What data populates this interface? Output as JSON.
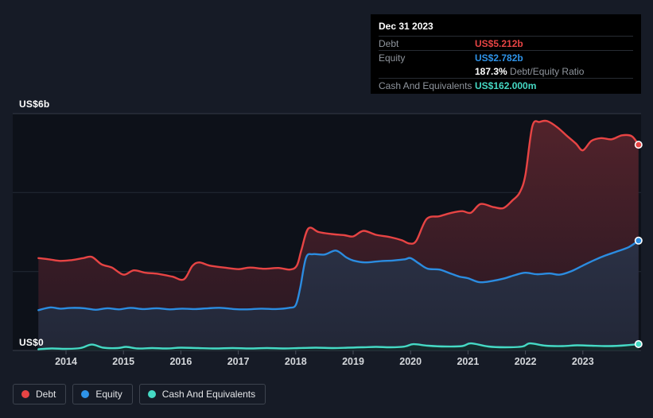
{
  "page": {
    "background": "#161b26"
  },
  "tooltip": {
    "date": "Dec 31 2023",
    "debt_label": "Debt",
    "debt_value": "US$5.212b",
    "equity_label": "Equity",
    "equity_value": "US$2.782b",
    "ratio_value": "187.3%",
    "ratio_label": "Debt/Equity Ratio",
    "cash_label": "Cash And Equivalents",
    "cash_value": "US$162.000m"
  },
  "legend": {
    "items": [
      {
        "label": "Debt",
        "color": "#e74444"
      },
      {
        "label": "Equity",
        "color": "#2e93e8"
      },
      {
        "label": "Cash And Equivalents",
        "color": "#45d9c4"
      }
    ]
  },
  "chart_data": {
    "type": "area",
    "title": "",
    "xlabel": "",
    "ylabel": "",
    "ylim": [
      0,
      6
    ],
    "x_range": [
      2013.5,
      2024.0
    ],
    "grid_values": [
      0,
      2,
      4,
      6
    ],
    "y_axis": {
      "top_label": "US$6b",
      "bottom_label": "US$0",
      "unit": "US$ billions"
    },
    "x_ticks": [
      "2014",
      "2015",
      "2016",
      "2017",
      "2018",
      "2019",
      "2020",
      "2021",
      "2022",
      "2023"
    ],
    "legend_position": "bottom-left",
    "grid": true,
    "series": [
      {
        "name": "Debt",
        "color": "#e74444",
        "fill_top": "#53232b",
        "fill_bottom": "#261722",
        "end_value_label": "US$5.212b",
        "points": [
          [
            2013.52,
            2.34
          ],
          [
            2013.7,
            2.31
          ],
          [
            2013.9,
            2.27
          ],
          [
            2014.1,
            2.29
          ],
          [
            2014.3,
            2.34
          ],
          [
            2014.45,
            2.37
          ],
          [
            2014.62,
            2.18
          ],
          [
            2014.8,
            2.1
          ],
          [
            2015.0,
            1.92
          ],
          [
            2015.18,
            2.03
          ],
          [
            2015.38,
            1.97
          ],
          [
            2015.6,
            1.94
          ],
          [
            2015.85,
            1.87
          ],
          [
            2016.05,
            1.8
          ],
          [
            2016.2,
            2.14
          ],
          [
            2016.32,
            2.23
          ],
          [
            2016.5,
            2.15
          ],
          [
            2016.75,
            2.1
          ],
          [
            2017.0,
            2.06
          ],
          [
            2017.2,
            2.1
          ],
          [
            2017.45,
            2.07
          ],
          [
            2017.7,
            2.09
          ],
          [
            2017.9,
            2.05
          ],
          [
            2018.02,
            2.15
          ],
          [
            2018.1,
            2.55
          ],
          [
            2018.22,
            3.09
          ],
          [
            2018.4,
            3.0
          ],
          [
            2018.62,
            2.95
          ],
          [
            2018.85,
            2.92
          ],
          [
            2019.0,
            2.89
          ],
          [
            2019.18,
            3.03
          ],
          [
            2019.4,
            2.93
          ],
          [
            2019.65,
            2.87
          ],
          [
            2019.85,
            2.79
          ],
          [
            2019.98,
            2.71
          ],
          [
            2020.1,
            2.78
          ],
          [
            2020.28,
            3.33
          ],
          [
            2020.5,
            3.4
          ],
          [
            2020.72,
            3.49
          ],
          [
            2020.9,
            3.53
          ],
          [
            2021.05,
            3.49
          ],
          [
            2021.22,
            3.71
          ],
          [
            2021.45,
            3.63
          ],
          [
            2021.62,
            3.61
          ],
          [
            2021.78,
            3.81
          ],
          [
            2021.9,
            4.0
          ],
          [
            2022.0,
            4.45
          ],
          [
            2022.12,
            5.68
          ],
          [
            2022.25,
            5.79
          ],
          [
            2022.38,
            5.81
          ],
          [
            2022.55,
            5.66
          ],
          [
            2022.72,
            5.44
          ],
          [
            2022.88,
            5.24
          ],
          [
            2023.0,
            5.07
          ],
          [
            2023.15,
            5.31
          ],
          [
            2023.32,
            5.38
          ],
          [
            2023.5,
            5.35
          ],
          [
            2023.68,
            5.45
          ],
          [
            2023.85,
            5.43
          ],
          [
            2023.97,
            5.212
          ]
        ]
      },
      {
        "name": "Equity",
        "color": "#2b8ce0",
        "fill_top": "#353c55",
        "fill_bottom": "#222737",
        "end_value_label": "US$2.782b",
        "points": [
          [
            2013.52,
            1.02
          ],
          [
            2013.72,
            1.09
          ],
          [
            2013.9,
            1.06
          ],
          [
            2014.1,
            1.08
          ],
          [
            2014.32,
            1.07
          ],
          [
            2014.52,
            1.03
          ],
          [
            2014.72,
            1.07
          ],
          [
            2014.92,
            1.04
          ],
          [
            2015.12,
            1.08
          ],
          [
            2015.35,
            1.05
          ],
          [
            2015.58,
            1.07
          ],
          [
            2015.8,
            1.04
          ],
          [
            2016.02,
            1.06
          ],
          [
            2016.25,
            1.05
          ],
          [
            2016.48,
            1.07
          ],
          [
            2016.7,
            1.08
          ],
          [
            2016.92,
            1.05
          ],
          [
            2017.15,
            1.04
          ],
          [
            2017.4,
            1.06
          ],
          [
            2017.65,
            1.05
          ],
          [
            2017.88,
            1.08
          ],
          [
            2018.0,
            1.15
          ],
          [
            2018.08,
            1.6
          ],
          [
            2018.18,
            2.35
          ],
          [
            2018.3,
            2.44
          ],
          [
            2018.5,
            2.43
          ],
          [
            2018.7,
            2.53
          ],
          [
            2018.88,
            2.36
          ],
          [
            2019.0,
            2.28
          ],
          [
            2019.2,
            2.23
          ],
          [
            2019.45,
            2.26
          ],
          [
            2019.7,
            2.28
          ],
          [
            2019.9,
            2.31
          ],
          [
            2020.0,
            2.34
          ],
          [
            2020.15,
            2.2
          ],
          [
            2020.3,
            2.07
          ],
          [
            2020.5,
            2.05
          ],
          [
            2020.68,
            1.96
          ],
          [
            2020.85,
            1.87
          ],
          [
            2021.0,
            1.83
          ],
          [
            2021.2,
            1.73
          ],
          [
            2021.42,
            1.76
          ],
          [
            2021.62,
            1.82
          ],
          [
            2021.82,
            1.91
          ],
          [
            2022.0,
            1.97
          ],
          [
            2022.2,
            1.93
          ],
          [
            2022.42,
            1.95
          ],
          [
            2022.6,
            1.92
          ],
          [
            2022.8,
            2.01
          ],
          [
            2023.0,
            2.15
          ],
          [
            2023.2,
            2.29
          ],
          [
            2023.4,
            2.41
          ],
          [
            2023.6,
            2.51
          ],
          [
            2023.8,
            2.62
          ],
          [
            2023.97,
            2.782
          ]
        ]
      },
      {
        "name": "Cash And Equivalents",
        "color": "#45d9c4",
        "fill_top": "#1d4a44",
        "fill_bottom": "#152b2c",
        "end_value_label": "US$162.000m",
        "points": [
          [
            2013.52,
            0.03
          ],
          [
            2013.75,
            0.05
          ],
          [
            2014.0,
            0.04
          ],
          [
            2014.25,
            0.06
          ],
          [
            2014.45,
            0.15
          ],
          [
            2014.65,
            0.07
          ],
          [
            2014.9,
            0.06
          ],
          [
            2015.05,
            0.09
          ],
          [
            2015.25,
            0.05
          ],
          [
            2015.5,
            0.06
          ],
          [
            2015.75,
            0.05
          ],
          [
            2016.0,
            0.07
          ],
          [
            2016.3,
            0.06
          ],
          [
            2016.6,
            0.05
          ],
          [
            2016.9,
            0.06
          ],
          [
            2017.2,
            0.05
          ],
          [
            2017.5,
            0.06
          ],
          [
            2017.8,
            0.05
          ],
          [
            2018.05,
            0.06
          ],
          [
            2018.35,
            0.07
          ],
          [
            2018.65,
            0.06
          ],
          [
            2018.9,
            0.07
          ],
          [
            2019.15,
            0.08
          ],
          [
            2019.4,
            0.09
          ],
          [
            2019.65,
            0.08
          ],
          [
            2019.9,
            0.1
          ],
          [
            2020.05,
            0.16
          ],
          [
            2020.3,
            0.12
          ],
          [
            2020.6,
            0.1
          ],
          [
            2020.9,
            0.11
          ],
          [
            2021.05,
            0.18
          ],
          [
            2021.35,
            0.1
          ],
          [
            2021.65,
            0.08
          ],
          [
            2021.95,
            0.1
          ],
          [
            2022.08,
            0.18
          ],
          [
            2022.35,
            0.12
          ],
          [
            2022.65,
            0.11
          ],
          [
            2022.9,
            0.13
          ],
          [
            2023.15,
            0.12
          ],
          [
            2023.45,
            0.11
          ],
          [
            2023.75,
            0.13
          ],
          [
            2023.97,
            0.162
          ]
        ]
      }
    ]
  }
}
